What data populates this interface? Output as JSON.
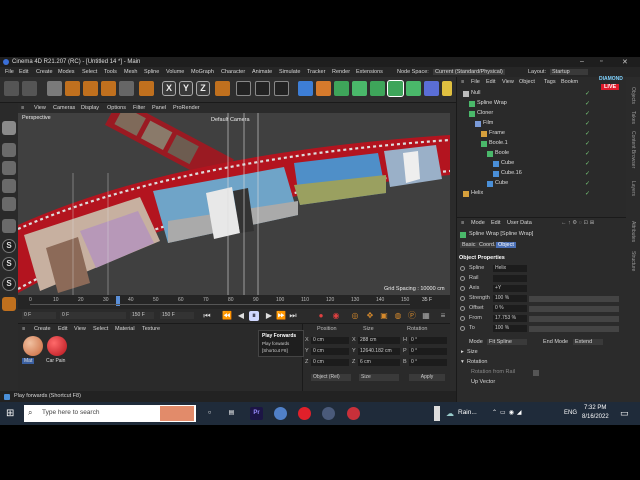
{
  "window": {
    "title": "Cinema 4D R21.207 (RC) - [Untitled 14 *] - Main"
  },
  "menu": {
    "items": [
      "File",
      "Edit",
      "Create",
      "Modes",
      "Select",
      "Tools",
      "Mesh",
      "Spline",
      "Volume",
      "MoGraph",
      "Character",
      "Animate",
      "Simulate",
      "Tracker",
      "Render",
      "Extensions"
    ],
    "node_space_label": "Node Space:",
    "node_space_value": "Current (Standard/Physical)",
    "layout_label": "Layout:",
    "layout_value": "Startup"
  },
  "viewport": {
    "menu": [
      "View",
      "Cameras",
      "Display",
      "Options",
      "Filter",
      "Panel",
      "ProRender"
    ],
    "name": "Perspective",
    "camera": "Default Camera",
    "grid_spacing": "Grid Spacing : 10000 cm"
  },
  "timeline": {
    "ticks": [
      "0",
      "10",
      "20",
      "30",
      "40",
      "50",
      "60",
      "70",
      "80",
      "90",
      "100",
      "110",
      "120",
      "130",
      "140",
      "150"
    ],
    "end_marker": "35 F",
    "current_frame": "35"
  },
  "transport": {
    "start_frame": "0 F",
    "start_min": "0 F",
    "end_max": "150 F",
    "end_frame": "150 F"
  },
  "tooltip": {
    "title": "Play Forwards",
    "line1": "Play forwards",
    "line2": "[Shortcut F8]"
  },
  "material_manager": {
    "menu": [
      "Create",
      "Edit",
      "View",
      "Select",
      "Material",
      "Texture"
    ],
    "materials": [
      {
        "name": "Mat",
        "color": "#c9663a"
      },
      {
        "name": "Car Pain",
        "color": "#b5121b"
      }
    ]
  },
  "coordinates": {
    "headers": {
      "position": "Position",
      "size": "Size",
      "rotation": "Rotation"
    },
    "rows": [
      {
        "axis": "X",
        "pos": "0 cm",
        "size_axis": "X",
        "size": "288 cm",
        "rot_axis": "H",
        "rot": "0 °"
      },
      {
        "axis": "Y",
        "pos": "0 cm",
        "size_axis": "Y",
        "size": "12640.182 cm",
        "rot_axis": "P",
        "rot": "0 °"
      },
      {
        "axis": "Z",
        "pos": "0 cm",
        "size_axis": "Z",
        "size": "6 cm",
        "rot_axis": "B",
        "rot": "0 °"
      }
    ],
    "mode": "Object (Rel)",
    "size_mode": "Size",
    "apply": "Apply"
  },
  "status": {
    "text": "Play forwards (Shortcut F8)"
  },
  "object_manager": {
    "menu": [
      "File",
      "Edit",
      "View",
      "Object",
      "Tags",
      "Bookm"
    ],
    "objects": [
      {
        "name": "Null",
        "indent": 0
      },
      {
        "name": "Spline Wrap",
        "indent": 1
      },
      {
        "name": "Cloner",
        "indent": 1
      },
      {
        "name": "Film",
        "indent": 2
      },
      {
        "name": "Frame",
        "indent": 3
      },
      {
        "name": "Boole.1",
        "indent": 3
      },
      {
        "name": "Boole",
        "indent": 4
      },
      {
        "name": "Cube",
        "indent": 5
      },
      {
        "name": "Cube.16",
        "indent": 5
      },
      {
        "name": "Cube",
        "indent": 4
      },
      {
        "name": "Helix",
        "indent": 0
      }
    ]
  },
  "attributes": {
    "menu": [
      "Mode",
      "Edit",
      "User Data"
    ],
    "object_title": "Spline Wrap [Spline Wrap]",
    "tabs": [
      "Basic",
      "Coord.",
      "Object"
    ],
    "section": "Object Properties",
    "props": [
      {
        "label": "Spline",
        "value": "Helix"
      },
      {
        "label": "Rail",
        "value": ""
      },
      {
        "label": "Axis",
        "value": "+Y"
      },
      {
        "label": "Strength",
        "value": "100 %"
      },
      {
        "label": "Offset",
        "value": "0 %"
      },
      {
        "label": "From",
        "value": "17.753 %"
      },
      {
        "label": "To",
        "value": "100 %"
      }
    ],
    "mode_label": "Mode",
    "mode_value": "Fit Spline",
    "end_mode_label": "End Mode",
    "end_mode_value": "Extend",
    "size_section": "Size",
    "rotation_section": "Rotation",
    "rotation_from_rail": "Rotation from Rail",
    "up_vector": "Up Vector"
  },
  "side_tabs": [
    "Objects",
    "Takes",
    "Content Browser",
    "Layers",
    "Attributes",
    "Structure"
  ],
  "taskbar": {
    "search_placeholder": "Type here to search",
    "weather": "Rain...",
    "lang": "ENG",
    "time": "7:32 PM",
    "date": "8/16/2022"
  },
  "brand": {
    "name": "DIAMOND",
    "live": "LIVE"
  }
}
